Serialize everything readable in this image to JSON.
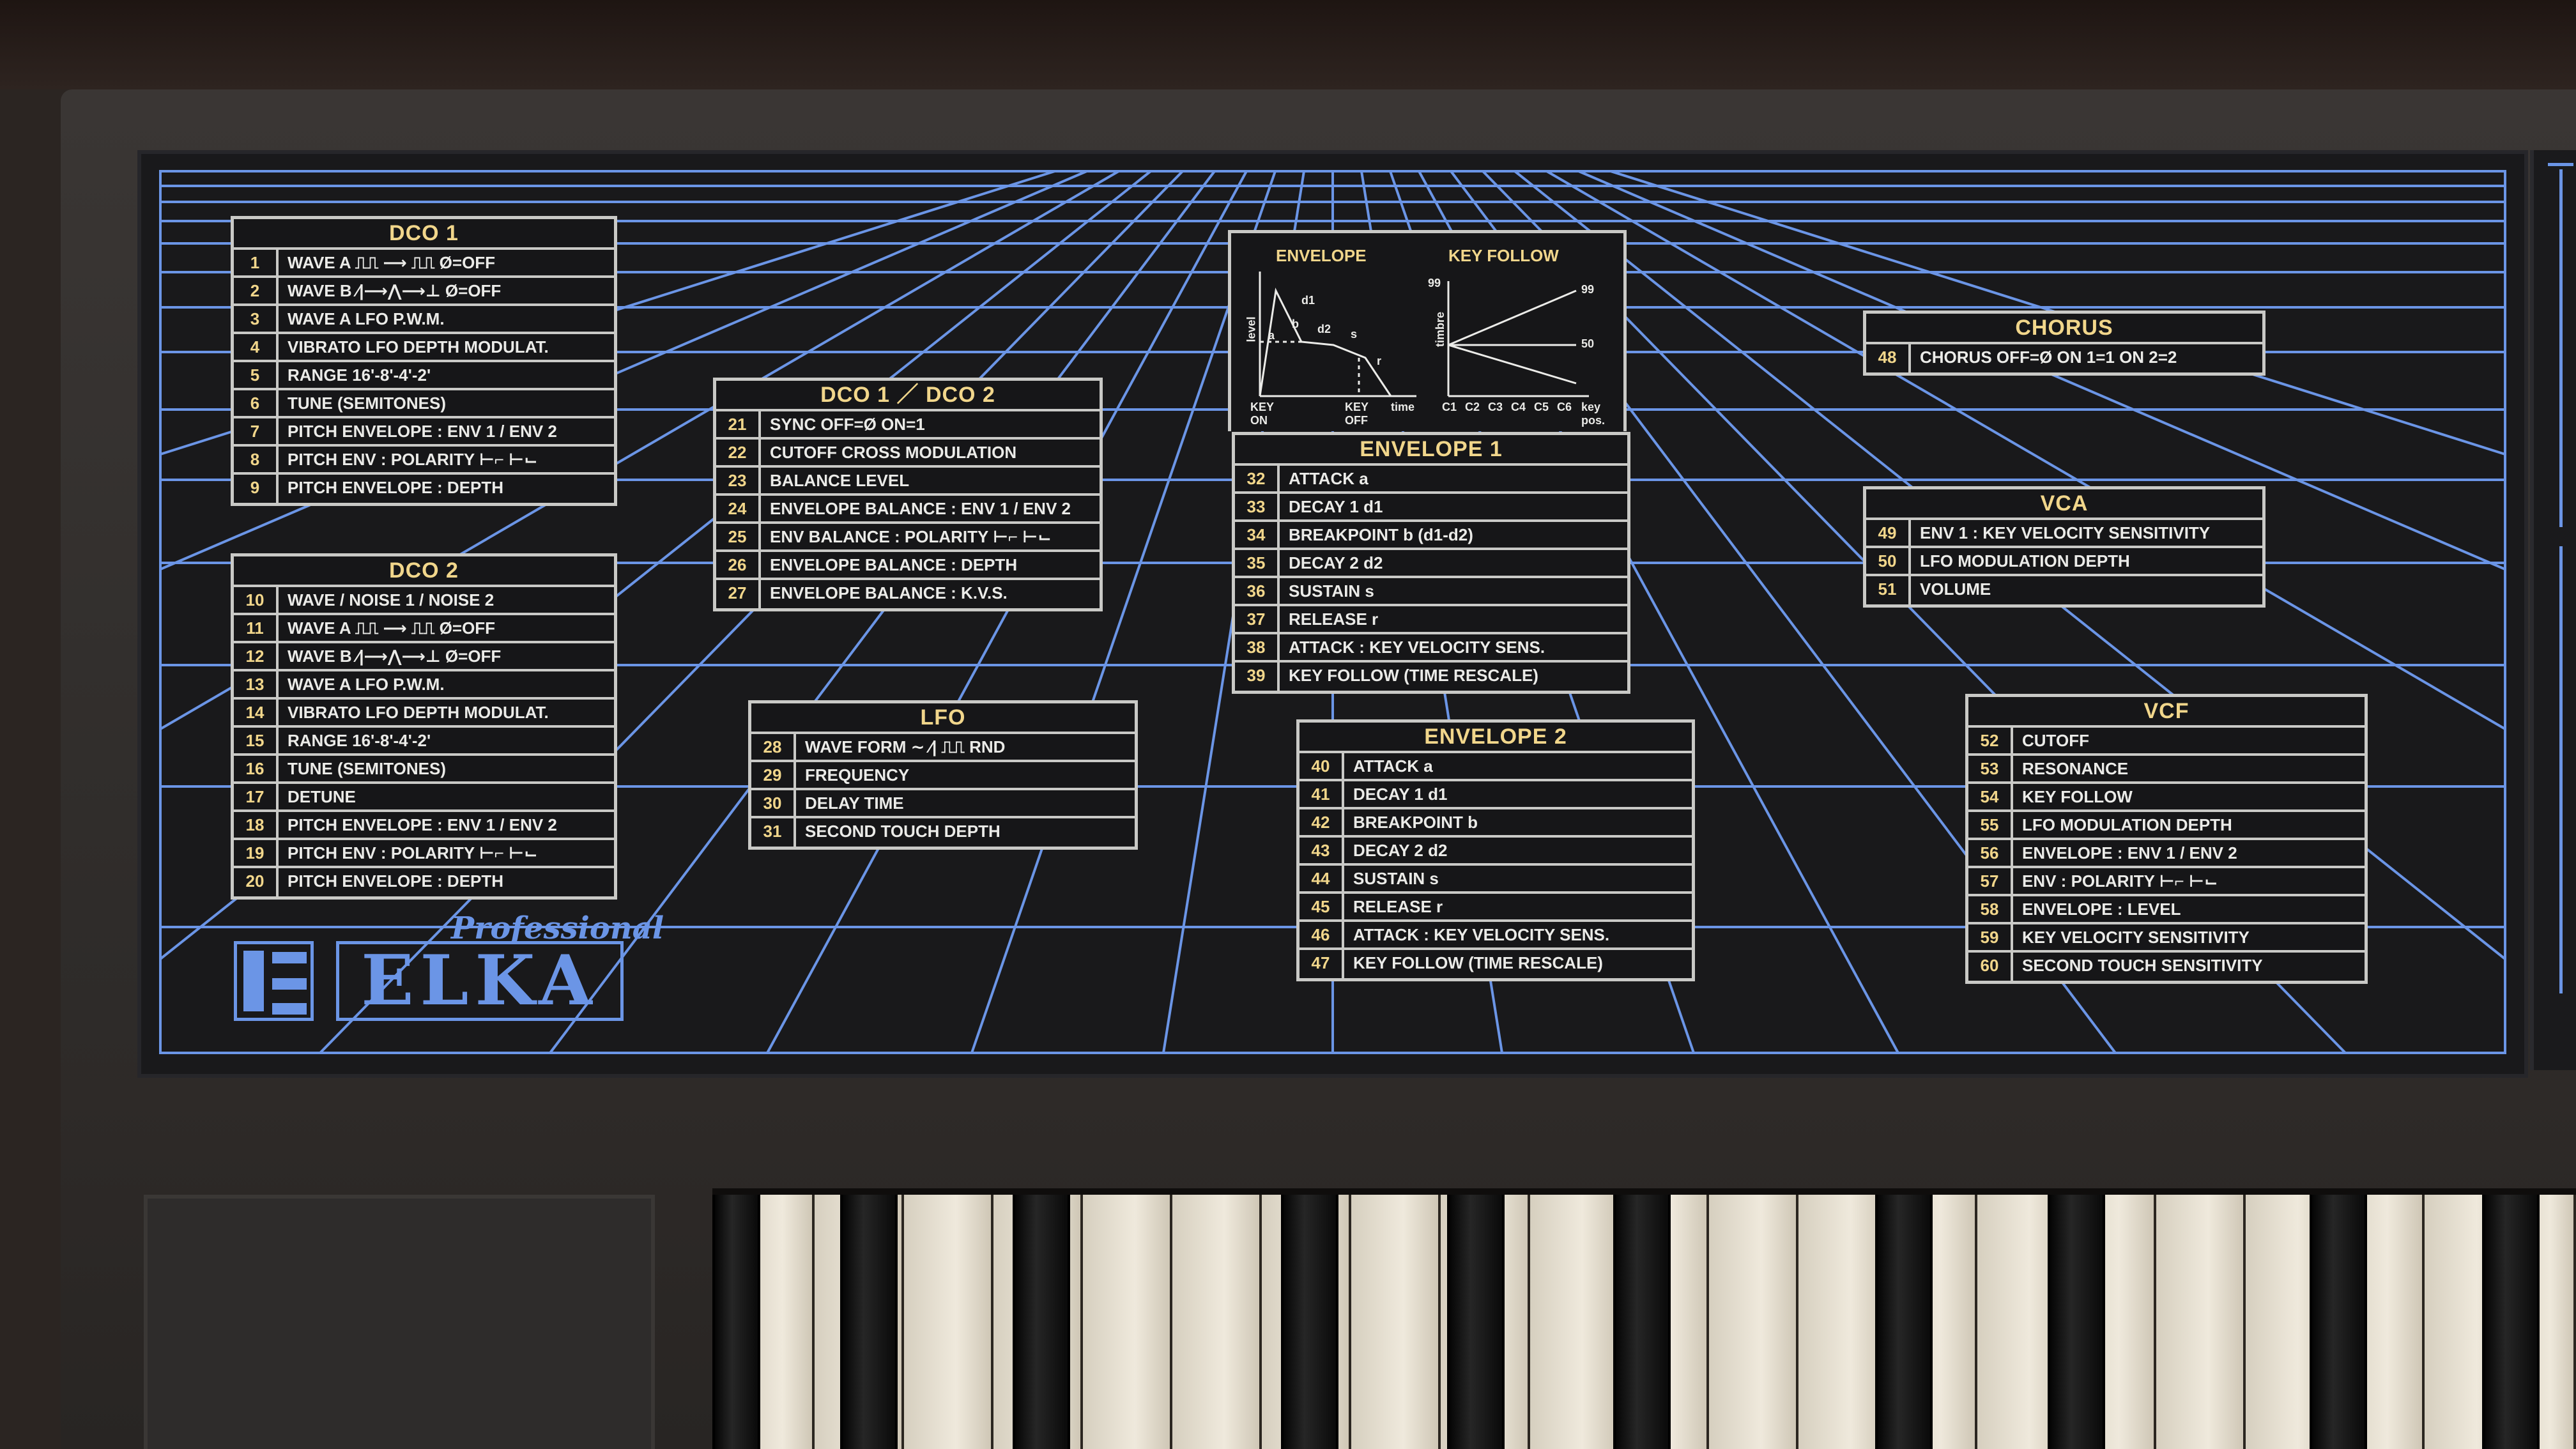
{
  "panel": {
    "dco1": {
      "title": "DCO 1",
      "rows": [
        {
          "n": "1",
          "t": "WAVE A   ⎍⎍  ⟶  ⎍⎍   Ø=OFF"
        },
        {
          "n": "2",
          "t": "WAVE B   ⁄|⟶⋀⟶⊥   Ø=OFF"
        },
        {
          "n": "3",
          "t": "WAVE A LFO P.W.M."
        },
        {
          "n": "4",
          "t": "VIBRATO LFO DEPTH MODULAT."
        },
        {
          "n": "5",
          "t": "RANGE 16'-8'-4'-2'"
        },
        {
          "n": "6",
          "t": "TUNE (SEMITONES)"
        },
        {
          "n": "7",
          "t": "PITCH ENVELOPE : ENV 1 / ENV 2"
        },
        {
          "n": "8",
          "t": "PITCH ENV : POLARITY ⊢⌐ ⊢⌙"
        },
        {
          "n": "9",
          "t": "PITCH ENVELOPE : DEPTH"
        }
      ]
    },
    "dco2": {
      "title": "DCO 2",
      "rows": [
        {
          "n": "10",
          "t": "WAVE / NOISE 1 / NOISE 2"
        },
        {
          "n": "11",
          "t": "WAVE A   ⎍⎍  ⟶  ⎍⎍   Ø=OFF"
        },
        {
          "n": "12",
          "t": "WAVE B   ⁄|⟶⋀⟶⊥   Ø=OFF"
        },
        {
          "n": "13",
          "t": "WAVE A LFO P.W.M."
        },
        {
          "n": "14",
          "t": "VIBRATO LFO DEPTH MODULAT."
        },
        {
          "n": "15",
          "t": "RANGE 16'-8'-4'-2'"
        },
        {
          "n": "16",
          "t": "TUNE (SEMITONES)"
        },
        {
          "n": "17",
          "t": "DETUNE"
        },
        {
          "n": "18",
          "t": "PITCH ENVELOPE : ENV 1 / ENV 2"
        },
        {
          "n": "19",
          "t": "PITCH ENV : POLARITY ⊢⌐ ⊢⌙"
        },
        {
          "n": "20",
          "t": "PITCH ENVELOPE : DEPTH"
        }
      ]
    },
    "dco12": {
      "title": "DCO 1 ／ DCO 2",
      "rows": [
        {
          "n": "21",
          "t": "SYNC             OFF=Ø     ON=1"
        },
        {
          "n": "22",
          "t": "CUTOFF CROSS MODULATION"
        },
        {
          "n": "23",
          "t": "BALANCE LEVEL"
        },
        {
          "n": "24",
          "t": "ENVELOPE BALANCE : ENV 1 / ENV 2"
        },
        {
          "n": "25",
          "t": "ENV BALANCE : POLARITY ⊢⌐ ⊢⌙"
        },
        {
          "n": "26",
          "t": "ENVELOPE BALANCE : DEPTH"
        },
        {
          "n": "27",
          "t": "ENVELOPE BALANCE : K.V.S."
        }
      ]
    },
    "lfo": {
      "title": "LFO",
      "rows": [
        {
          "n": "28",
          "t": "WAVE FORM      ∼   ⁄|   ⎍⎍    RND"
        },
        {
          "n": "29",
          "t": "FREQUENCY"
        },
        {
          "n": "30",
          "t": "DELAY TIME"
        },
        {
          "n": "31",
          "t": "SECOND TOUCH DEPTH"
        }
      ]
    },
    "graph": {
      "envelope_label": "ENVELOPE",
      "keyfollow_label": "KEY FOLLOW",
      "level": "level",
      "time": "time",
      "timbre": "timbre",
      "key_on": "KEY ON",
      "key_off": "KEY OFF",
      "key_pos": "key pos.",
      "a": "a",
      "d1": "d1",
      "b": "b",
      "d2": "d2",
      "s": "s",
      "r": "r",
      "v99a": "99",
      "v99b": "99",
      "v50": "50",
      "c_labels": "C1  C2  C3  C4  C5  C6"
    },
    "env1": {
      "title": "ENVELOPE  1",
      "rows": [
        {
          "n": "32",
          "t": "ATTACK  a"
        },
        {
          "n": "33",
          "t": "DECAY 1  d1"
        },
        {
          "n": "34",
          "t": "BREAKPOINT  b    (d1-d2)"
        },
        {
          "n": "35",
          "t": "DECAY 2  d2"
        },
        {
          "n": "36",
          "t": "SUSTAIN  s"
        },
        {
          "n": "37",
          "t": "RELEASE  r"
        },
        {
          "n": "38",
          "t": "ATTACK : KEY VELOCITY SENS."
        },
        {
          "n": "39",
          "t": "KEY FOLLOW (TIME RESCALE)"
        }
      ]
    },
    "env2": {
      "title": "ENVELOPE  2",
      "rows": [
        {
          "n": "40",
          "t": "ATTACK  a"
        },
        {
          "n": "41",
          "t": "DECAY 1  d1"
        },
        {
          "n": "42",
          "t": "BREAKPOINT  b"
        },
        {
          "n": "43",
          "t": "DECAY 2  d2"
        },
        {
          "n": "44",
          "t": "SUSTAIN  s"
        },
        {
          "n": "45",
          "t": "RELEASE  r"
        },
        {
          "n": "46",
          "t": "ATTACK : KEY VELOCITY SENS."
        },
        {
          "n": "47",
          "t": "KEY FOLLOW (TIME RESCALE)"
        }
      ]
    },
    "chorus": {
      "title": "CHORUS",
      "rows": [
        {
          "n": "48",
          "t": "CHORUS  OFF=Ø  ON 1=1  ON 2=2"
        }
      ]
    },
    "vca": {
      "title": "VCA",
      "rows": [
        {
          "n": "49",
          "t": "ENV 1 : KEY VELOCITY SENSITIVITY"
        },
        {
          "n": "50",
          "t": "LFO MODULATION DEPTH"
        },
        {
          "n": "51",
          "t": "VOLUME"
        }
      ]
    },
    "vcf": {
      "title": "VCF",
      "rows": [
        {
          "n": "52",
          "t": "CUTOFF"
        },
        {
          "n": "53",
          "t": "RESONANCE"
        },
        {
          "n": "54",
          "t": "KEY FOLLOW"
        },
        {
          "n": "55",
          "t": "LFO MODULATION DEPTH"
        },
        {
          "n": "56",
          "t": "ENVELOPE : ENV 1 / ENV 2"
        },
        {
          "n": "57",
          "t": "ENV : POLARITY ⊢⌐ ⊢⌙"
        },
        {
          "n": "58",
          "t": "ENVELOPE : LEVEL"
        },
        {
          "n": "59",
          "t": "KEY VELOCITY SENSITIVITY"
        },
        {
          "n": "60",
          "t": "SECOND TOUCH SENSITIVITY"
        }
      ]
    }
  },
  "logo": {
    "brand": "ELKA",
    "tagline": "Professional"
  },
  "colors": {
    "grid_blue": "#6b95e6",
    "label_gold": "#f1d68b",
    "text_white": "#ebebe8"
  }
}
